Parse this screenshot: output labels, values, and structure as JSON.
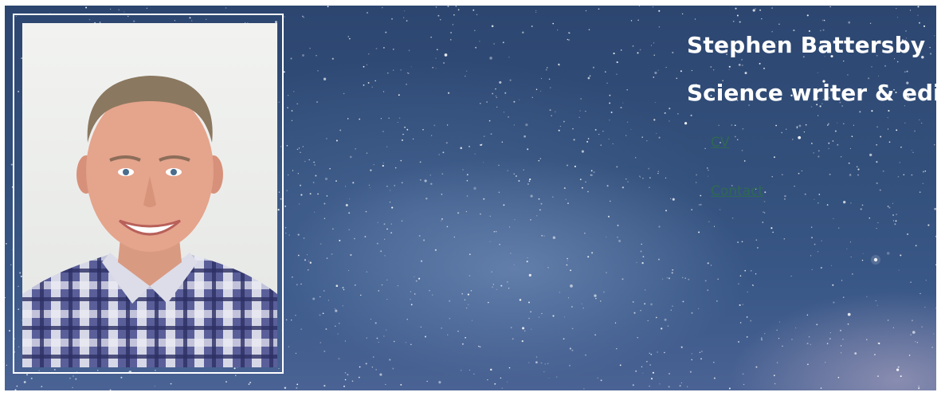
{
  "header": {
    "name": "Stephen Battersby",
    "tagline": "Science writer & editor"
  },
  "nav": {
    "items": [
      {
        "label": "CV"
      },
      {
        "label": "Contact"
      }
    ]
  },
  "colors": {
    "sky": "#33507c",
    "heading_text": "#ffffff",
    "link": "#2f6e4c",
    "frame": "#ffffff"
  }
}
